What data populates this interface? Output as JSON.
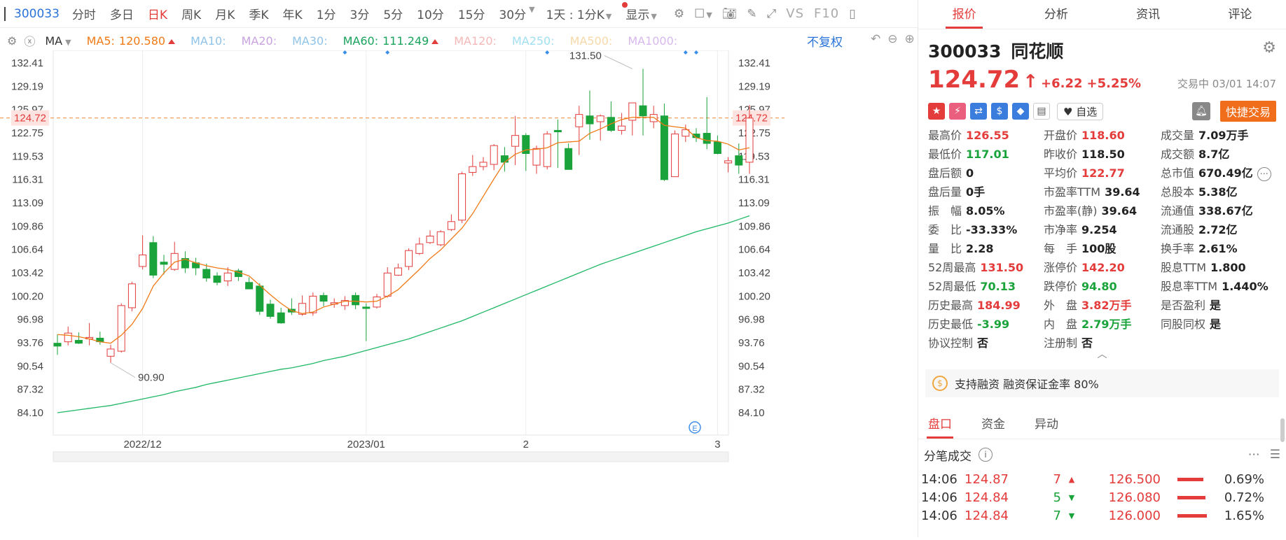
{
  "toolbar": {
    "code": "300033",
    "periods": [
      "分时",
      "多日",
      "日K",
      "周K",
      "月K",
      "季K",
      "年K",
      "1分",
      "3分",
      "5分",
      "10分",
      "15分",
      "30分"
    ],
    "active_period": "日K",
    "interval_select": "1天 : 1分K",
    "display_label": "显示",
    "vs_label": "VS",
    "f10_label": "F10"
  },
  "ma_bar": {
    "ma_label": "MA",
    "items": [
      {
        "label": "MA5:",
        "value": "120.580",
        "color": "#f07a16",
        "arrow": true
      },
      {
        "label": "MA10:",
        "value": "",
        "color": "#8fc3ea",
        "arrow": false
      },
      {
        "label": "MA20:",
        "value": "",
        "color": "#c8a3e0",
        "arrow": false
      },
      {
        "label": "MA30:",
        "value": "",
        "color": "#8fc3ea",
        "arrow": false
      },
      {
        "label": "MA60:",
        "value": "111.249",
        "color": "#1aa35c",
        "arrow": true
      },
      {
        "label": "MA120:",
        "value": "",
        "color": "#f4b8b8",
        "arrow": false
      },
      {
        "label": "MA250:",
        "value": "",
        "color": "#a0dff0",
        "arrow": false
      },
      {
        "label": "MA500:",
        "value": "",
        "color": "#f7d9a8",
        "arrow": false
      },
      {
        "label": "MA1000:",
        "value": "",
        "color": "#d7b9ee",
        "arrow": false
      }
    ],
    "fq_label": "不复权"
  },
  "chart_data": {
    "type": "candlestick",
    "y_ticks": [
      "132.41",
      "129.19",
      "125.97",
      "122.75",
      "119.53",
      "116.31",
      "113.09",
      "109.86",
      "106.64",
      "103.42",
      "100.20",
      "96.98",
      "93.76",
      "90.54",
      "87.32",
      "84.10"
    ],
    "ylim": [
      84.1,
      132.41
    ],
    "x_labels": [
      {
        "label": "2022/12",
        "index": 8
      },
      {
        "label": "2023/01",
        "index": 29
      },
      {
        "label": "2",
        "index": 44
      },
      {
        "label": "3",
        "index": 62
      }
    ],
    "current_price": {
      "value": 124.72,
      "label": "124.72"
    },
    "annotations": [
      {
        "label": "131.50",
        "value": 131.5,
        "index": 54
      },
      {
        "label": "90.90",
        "value": 90.9,
        "index": 5
      }
    ],
    "event_markers": [
      27,
      31,
      46,
      59,
      60
    ],
    "candles": [
      {
        "o": 93.6,
        "h": 94.8,
        "l": 92.0,
        "c": 93.2
      },
      {
        "o": 93.8,
        "h": 95.9,
        "l": 93.3,
        "c": 95.0
      },
      {
        "o": 94.0,
        "h": 95.1,
        "l": 93.5,
        "c": 93.6
      },
      {
        "o": 94.2,
        "h": 96.4,
        "l": 93.3,
        "c": 94.4
      },
      {
        "o": 94.3,
        "h": 95.2,
        "l": 93.4,
        "c": 93.8
      },
      {
        "o": 91.8,
        "h": 93.4,
        "l": 90.9,
        "c": 92.8
      },
      {
        "o": 92.5,
        "h": 99.1,
        "l": 92.3,
        "c": 98.8
      },
      {
        "o": 98.5,
        "h": 102.1,
        "l": 98.0,
        "c": 101.8
      },
      {
        "o": 104.2,
        "h": 108.5,
        "l": 103.8,
        "c": 105.8
      },
      {
        "o": 107.5,
        "h": 108.4,
        "l": 102.6,
        "c": 103.0
      },
      {
        "o": 104.8,
        "h": 105.8,
        "l": 103.1,
        "c": 104.5
      },
      {
        "o": 103.8,
        "h": 107.6,
        "l": 103.6,
        "c": 106.0
      },
      {
        "o": 105.3,
        "h": 106.3,
        "l": 103.3,
        "c": 104.0
      },
      {
        "o": 104.7,
        "h": 105.4,
        "l": 103.0,
        "c": 104.0
      },
      {
        "o": 103.8,
        "h": 104.6,
        "l": 102.1,
        "c": 102.6
      },
      {
        "o": 102.9,
        "h": 103.4,
        "l": 101.6,
        "c": 102.0
      },
      {
        "o": 102.2,
        "h": 104.1,
        "l": 101.5,
        "c": 103.3
      },
      {
        "o": 103.6,
        "h": 103.9,
        "l": 102.2,
        "c": 102.8
      },
      {
        "o": 102.0,
        "h": 102.7,
        "l": 101.2,
        "c": 101.1
      },
      {
        "o": 101.5,
        "h": 101.9,
        "l": 97.5,
        "c": 98.0
      },
      {
        "o": 99.0,
        "h": 99.6,
        "l": 97.0,
        "c": 97.3
      },
      {
        "o": 97.8,
        "h": 98.5,
        "l": 96.3,
        "c": 96.4
      },
      {
        "o": 98.3,
        "h": 99.8,
        "l": 97.5,
        "c": 97.9
      },
      {
        "o": 97.6,
        "h": 100.2,
        "l": 97.4,
        "c": 99.1
      },
      {
        "o": 97.8,
        "h": 100.6,
        "l": 97.4,
        "c": 100.1
      },
      {
        "o": 100.2,
        "h": 100.6,
        "l": 98.7,
        "c": 99.4
      },
      {
        "o": 99.0,
        "h": 99.8,
        "l": 98.5,
        "c": 99.2
      },
      {
        "o": 98.8,
        "h": 100.1,
        "l": 98.2,
        "c": 99.5
      },
      {
        "o": 100.2,
        "h": 100.6,
        "l": 98.3,
        "c": 98.9
      },
      {
        "o": 98.6,
        "h": 99.1,
        "l": 93.9,
        "c": 98.4
      },
      {
        "o": 98.6,
        "h": 100.4,
        "l": 98.4,
        "c": 100.0
      },
      {
        "o": 100.1,
        "h": 104.1,
        "l": 99.9,
        "c": 103.3
      },
      {
        "o": 103.0,
        "h": 104.6,
        "l": 102.9,
        "c": 104.0
      },
      {
        "o": 104.2,
        "h": 106.7,
        "l": 103.7,
        "c": 106.4
      },
      {
        "o": 106.0,
        "h": 108.2,
        "l": 105.8,
        "c": 107.3
      },
      {
        "o": 107.5,
        "h": 109.2,
        "l": 107.3,
        "c": 108.4
      },
      {
        "o": 107.2,
        "h": 109.2,
        "l": 107.0,
        "c": 109.0
      },
      {
        "o": 109.3,
        "h": 111.4,
        "l": 109.1,
        "c": 110.4
      },
      {
        "o": 110.6,
        "h": 117.3,
        "l": 110.2,
        "c": 117.0
      },
      {
        "o": 117.2,
        "h": 119.6,
        "l": 116.7,
        "c": 118.0
      },
      {
        "o": 118.0,
        "h": 119.3,
        "l": 117.5,
        "c": 118.6
      },
      {
        "o": 118.3,
        "h": 121.1,
        "l": 117.5,
        "c": 120.9
      },
      {
        "o": 119.5,
        "h": 120.7,
        "l": 117.3,
        "c": 118.6
      },
      {
        "o": 120.8,
        "h": 125.0,
        "l": 118.2,
        "c": 122.3
      },
      {
        "o": 122.3,
        "h": 122.6,
        "l": 117.4,
        "c": 119.8
      },
      {
        "o": 118.2,
        "h": 120.9,
        "l": 117.0,
        "c": 120.5
      },
      {
        "o": 118.0,
        "h": 122.9,
        "l": 117.6,
        "c": 122.5
      },
      {
        "o": 123.0,
        "h": 124.5,
        "l": 117.8,
        "c": 122.8
      },
      {
        "o": 120.5,
        "h": 121.2,
        "l": 117.8,
        "c": 117.6
      },
      {
        "o": 123.5,
        "h": 126.4,
        "l": 119.6,
        "c": 125.2
      },
      {
        "o": 125.0,
        "h": 128.5,
        "l": 121.7,
        "c": 123.9
      },
      {
        "o": 124.2,
        "h": 125.2,
        "l": 121.6,
        "c": 125.0
      },
      {
        "o": 124.8,
        "h": 127.0,
        "l": 122.8,
        "c": 123.0
      },
      {
        "o": 123.0,
        "h": 125.4,
        "l": 122.4,
        "c": 123.6
      },
      {
        "o": 124.4,
        "h": 125.6,
        "l": 122.3,
        "c": 126.8
      },
      {
        "o": 126.4,
        "h": 131.5,
        "l": 122.3,
        "c": 125.0
      },
      {
        "o": 124.2,
        "h": 126.4,
        "l": 123.3,
        "c": 125.2
      },
      {
        "o": 125.0,
        "h": 126.7,
        "l": 116.0,
        "c": 116.2
      },
      {
        "o": 116.6,
        "h": 123.0,
        "l": 116.6,
        "c": 122.5
      },
      {
        "o": 122.2,
        "h": 123.8,
        "l": 121.4,
        "c": 123.1
      },
      {
        "o": 122.5,
        "h": 123.3,
        "l": 121.4,
        "c": 122.0
      },
      {
        "o": 122.6,
        "h": 127.6,
        "l": 120.4,
        "c": 121.2
      },
      {
        "o": 121.4,
        "h": 122.3,
        "l": 119.7,
        "c": 119.8
      },
      {
        "o": 118.5,
        "h": 119.3,
        "l": 117.2,
        "c": 118.8
      },
      {
        "o": 119.5,
        "h": 121.2,
        "l": 117.0,
        "c": 118.2
      },
      {
        "o": 118.6,
        "h": 126.5,
        "l": 117.0,
        "c": 124.7
      }
    ],
    "ma5": [
      94.8,
      94.7,
      94.5,
      94.2,
      93.8,
      93.6,
      94.7,
      96.2,
      98.4,
      101.5,
      103.3,
      104.8,
      105.2,
      104.7,
      104.3,
      104.0,
      103.8,
      103.4,
      102.9,
      101.6,
      100.3,
      99.1,
      98.1,
      97.7,
      97.9,
      98.6,
      99.0,
      99.4,
      99.4,
      99.3,
      99.4,
      100.1,
      101.0,
      102.4,
      103.8,
      105.3,
      106.5,
      108.0,
      109.5,
      111.5,
      113.9,
      116.3,
      118.6,
      119.7,
      120.3,
      120.4,
      120.6,
      121.3,
      121.4,
      121.5,
      122.6,
      123.2,
      123.9,
      124.5,
      124.8,
      124.8,
      124.8,
      123.7,
      123.5,
      123.3,
      122.0,
      121.6,
      121.5,
      121.1,
      120.3,
      120.6
    ],
    "ma60": [
      84.0,
      84.2,
      84.4,
      84.6,
      84.8,
      85.0,
      85.3,
      85.6,
      85.9,
      86.2,
      86.5,
      86.9,
      87.2,
      87.5,
      87.9,
      88.2,
      88.5,
      88.8,
      89.1,
      89.4,
      89.7,
      90.0,
      90.2,
      90.5,
      90.8,
      91.2,
      91.5,
      91.8,
      92.2,
      92.6,
      93.0,
      93.4,
      93.8,
      94.2,
      94.7,
      95.2,
      95.7,
      96.2,
      96.7,
      97.3,
      97.9,
      98.5,
      99.1,
      99.7,
      100.3,
      100.9,
      101.5,
      102.1,
      102.7,
      103.3,
      103.9,
      104.5,
      105.0,
      105.5,
      106.0,
      106.5,
      107.0,
      107.5,
      108.0,
      108.5,
      109.0,
      109.4,
      109.8,
      110.2,
      110.7,
      111.2
    ]
  },
  "stock": {
    "code": "300033",
    "name": "同花顺",
    "price": "124.72",
    "change": "+6.22",
    "change_pct": "+5.25%",
    "status_time": "交易中 03/01 14:07",
    "watch_label": "自选",
    "quick_trade_label": "快捷交易"
  },
  "tabs": [
    "报价",
    "分析",
    "资讯",
    "评论"
  ],
  "quote_grid": [
    {
      "label": "最高价",
      "value": "126.55",
      "cls": "up"
    },
    {
      "label": "开盘价",
      "value": "118.60",
      "cls": "up"
    },
    {
      "label": "成交量",
      "value": "7.09万手",
      "cls": ""
    },
    {
      "label": "最低价",
      "value": "117.01",
      "cls": "down"
    },
    {
      "label": "昨收价",
      "value": "118.50",
      "cls": ""
    },
    {
      "label": "成交额",
      "value": "8.7亿",
      "cls": ""
    },
    {
      "label": "盘后额",
      "value": "0",
      "cls": ""
    },
    {
      "label": "平均价",
      "value": "122.77",
      "cls": "up"
    },
    {
      "label": "总市值",
      "value": "670.49亿",
      "cls": "",
      "more": true
    },
    {
      "label": "盘后量",
      "value": "0手",
      "cls": ""
    },
    {
      "label": "市盈率TTM",
      "value": "39.64",
      "cls": ""
    },
    {
      "label": "总股本",
      "value": "5.38亿",
      "cls": ""
    },
    {
      "label": "振　幅",
      "value": "8.05%",
      "cls": ""
    },
    {
      "label": "市盈率(静)",
      "value": "39.64",
      "cls": ""
    },
    {
      "label": "流通值",
      "value": "338.67亿",
      "cls": ""
    },
    {
      "label": "委　比",
      "value": "-33.33%",
      "cls": ""
    },
    {
      "label": "市净率",
      "value": "9.254",
      "cls": ""
    },
    {
      "label": "流通股",
      "value": "2.72亿",
      "cls": ""
    },
    {
      "label": "量　比",
      "value": "2.28",
      "cls": ""
    },
    {
      "label": "每　手",
      "value": "100股",
      "cls": ""
    },
    {
      "label": "换手率",
      "value": "2.61%",
      "cls": ""
    },
    {
      "label": "52周最高",
      "value": "131.50",
      "cls": "up"
    },
    {
      "label": "涨停价",
      "value": "142.20",
      "cls": "up"
    },
    {
      "label": "股息TTM",
      "value": "1.800",
      "cls": ""
    },
    {
      "label": "52周最低",
      "value": "70.13",
      "cls": "down"
    },
    {
      "label": "跌停价",
      "value": "94.80",
      "cls": "down"
    },
    {
      "label": "股息率TTM",
      "value": "1.440%",
      "cls": ""
    },
    {
      "label": "历史最高",
      "value": "184.99",
      "cls": "up"
    },
    {
      "label": "外　盘",
      "value": "3.82万手",
      "cls": "up"
    },
    {
      "label": "是否盈利",
      "value": "是",
      "cls": ""
    },
    {
      "label": "历史最低",
      "value": "-3.99",
      "cls": "down"
    },
    {
      "label": "内　盘",
      "value": "2.79万手",
      "cls": "down"
    },
    {
      "label": "同股同权",
      "value": "是",
      "cls": ""
    },
    {
      "label": "协议控制",
      "value": "否",
      "cls": ""
    },
    {
      "label": "注册制",
      "value": "否",
      "cls": ""
    }
  ],
  "margin": {
    "text": "支持融资 融资保证金率 80%"
  },
  "panel_tabs": [
    "盘口",
    "资金",
    "异动"
  ],
  "trades": {
    "title": "分笔成交",
    "rows": [
      {
        "time": "14:06",
        "price": "124.87",
        "vol": "7",
        "dir": "up",
        "pprice": "126.500",
        "bar": 0.58,
        "pct": "0.69%"
      },
      {
        "time": "14:06",
        "price": "124.84",
        "vol": "5",
        "dir": "down",
        "pprice": "126.080",
        "bar": 0.62,
        "pct": "0.72%"
      },
      {
        "time": "14:06",
        "price": "124.84",
        "vol": "7",
        "dir": "down",
        "pprice": "126.000",
        "bar": 0.66,
        "pct": "1.65%"
      }
    ]
  }
}
